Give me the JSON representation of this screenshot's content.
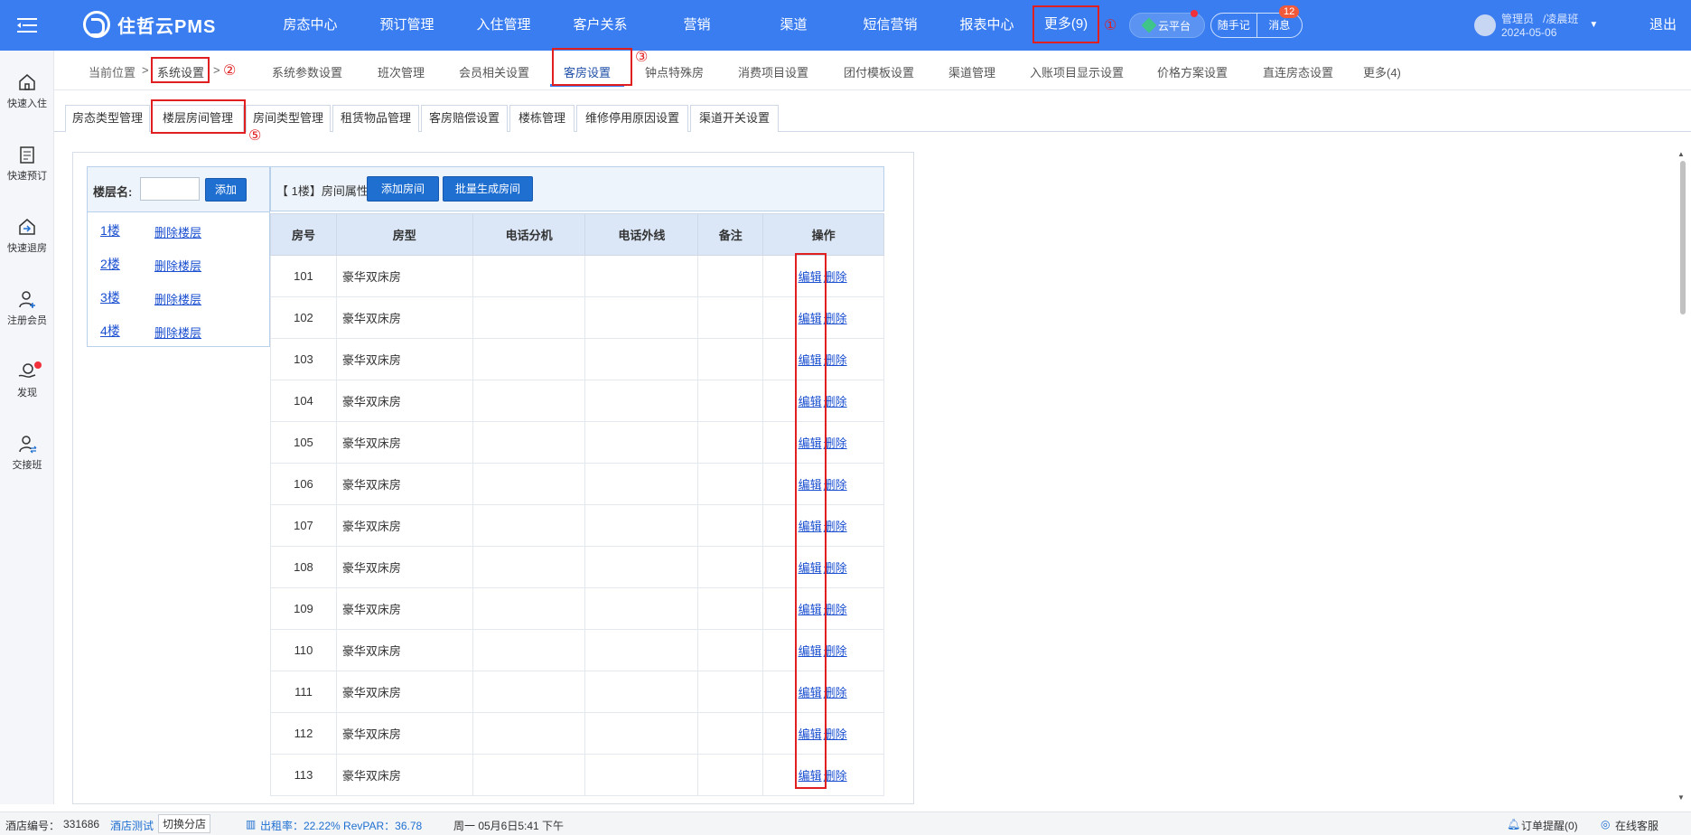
{
  "app": {
    "name": "住哲云PMS"
  },
  "nav": [
    "房态中心",
    "预订管理",
    "入住管理",
    "客户关系",
    "营销",
    "渠道",
    "短信营销",
    "报表中心"
  ],
  "nav_more": "更多(9)",
  "markers": [
    "①",
    "②",
    "③",
    "⑤"
  ],
  "header": {
    "cloud": "云平台",
    "notes": "随手记",
    "messages": "消息",
    "badge": "12",
    "user_role": "管理员",
    "user_shift": "/凌晨班",
    "date": "2024-05-06",
    "logout": "退出"
  },
  "sidebar": [
    "快速入住",
    "快速预订",
    "快速退房",
    "注册会员",
    "发现",
    "交接班"
  ],
  "breadcrumb": {
    "prefix": "当前位置",
    "sep": ">",
    "current": "系统设置"
  },
  "settings_tabs": [
    "系统参数设置",
    "班次管理",
    "会员相关设置",
    "客房设置",
    "钟点特殊房",
    "消费项目设置",
    "团付模板设置",
    "渠道管理",
    "入账项目显示设置",
    "价格方案设置",
    "直连房态设置",
    "更多(4)"
  ],
  "sub_tabs": [
    "房态类型管理",
    "楼层房间管理",
    "房间类型管理",
    "租赁物品管理",
    "客房赔偿设置",
    "楼栋管理",
    "维修停用原因设置",
    "渠道开关设置"
  ],
  "floor_panel": {
    "label": "楼层名:",
    "input_value": "",
    "add_button": "添加",
    "floors": [
      {
        "name": "1楼",
        "delete": "删除楼层"
      },
      {
        "name": "2楼",
        "delete": "删除楼层"
      },
      {
        "name": "3楼",
        "delete": "删除楼层"
      },
      {
        "name": "4楼",
        "delete": "删除楼层"
      }
    ]
  },
  "room_panel": {
    "title": "【 1楼】房间属性",
    "add_room": "添加房间",
    "batch_create": "批量生成房间",
    "columns": [
      "房号",
      "房型",
      "电话分机",
      "电话外线",
      "备注",
      "操作"
    ],
    "edit": "编辑",
    "delete": "删除",
    "rows": [
      {
        "no": "101",
        "type": "豪华双床房"
      },
      {
        "no": "102",
        "type": "豪华双床房"
      },
      {
        "no": "103",
        "type": "豪华双床房"
      },
      {
        "no": "104",
        "type": "豪华双床房"
      },
      {
        "no": "105",
        "type": "豪华双床房"
      },
      {
        "no": "106",
        "type": "豪华双床房"
      },
      {
        "no": "107",
        "type": "豪华双床房"
      },
      {
        "no": "108",
        "type": "豪华双床房"
      },
      {
        "no": "109",
        "type": "豪华双床房"
      },
      {
        "no": "110",
        "type": "豪华双床房"
      },
      {
        "no": "111",
        "type": "豪华双床房"
      },
      {
        "no": "112",
        "type": "豪华双床房"
      },
      {
        "no": "113",
        "type": "豪华双床房"
      }
    ]
  },
  "status": {
    "hotel_label": "酒店编号：",
    "hotel_no": "331686",
    "hotel_name": "酒店测试",
    "switch": "切换分店",
    "occupancy": "出租率：22.22% RevPAR：36.78",
    "datetime": "周一 05月6日5:41 下午",
    "orders": "订单提醒(0)",
    "service": "在线客服"
  },
  "colors": {
    "primary": "#3a7df0",
    "annotation": "#e02020",
    "link": "#1a4fd0"
  }
}
